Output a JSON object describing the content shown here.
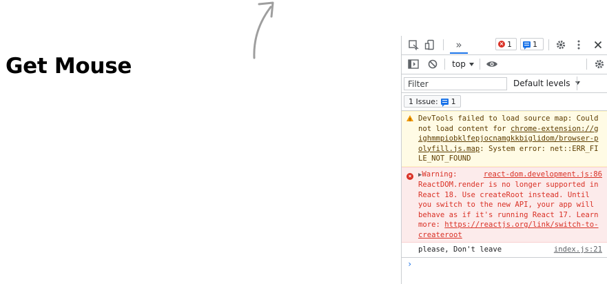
{
  "page": {
    "heading": "Get Mouse"
  },
  "devtools": {
    "toolbar": {
      "more_tabs": "»",
      "error_count": "1",
      "message_count": "1"
    },
    "console_toolbar": {
      "context": "top"
    },
    "filter": {
      "placeholder": "Filter",
      "levels_label": "Default levels"
    },
    "issues": {
      "label": "1 Issue:",
      "count": "1"
    },
    "entries": [
      {
        "level": "warning",
        "text_before": "DevTools failed to load source map: Could not load content for ",
        "link": "chrome-extension://gighmmpiobklfepjocnamgkkbiglidom/browser-polyfill.js.map",
        "text_after": ": System error: net::ERR_FILE_NOT_FOUND"
      },
      {
        "level": "error",
        "label": "Warning:",
        "source": "react-dom.development.js:86",
        "text": "ReactDOM.render is no longer supported in React 18. Use createRoot instead. Until you switch to the new API, your app will behave as if it's running React 17. Learn more: ",
        "link": "https://reactjs.org/link/switch-to-createroot"
      },
      {
        "level": "info",
        "text": "please, Don't leave",
        "source": "index.js:21"
      }
    ],
    "prompt": "›"
  }
}
